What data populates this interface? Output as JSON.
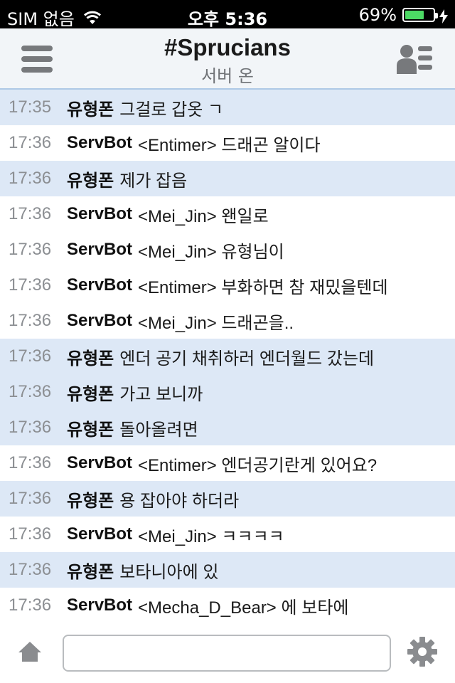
{
  "status_bar": {
    "carrier": "SIM 없음",
    "time": "오후 5:36",
    "battery_percent": "69%",
    "battery_level": 0.69
  },
  "header": {
    "title": "#Sprucians",
    "subtitle": "서버 온",
    "menu_icon": "hamburger-menu-icon",
    "users_icon": "user-list-icon"
  },
  "messages": [
    {
      "time": "17:35",
      "nick": "유형폰",
      "text": "그걸로 갑옷 ㄱ",
      "highlight": true
    },
    {
      "time": "17:36",
      "nick": "ServBot",
      "text": "<Entimer> 드래곤 알이다",
      "highlight": false
    },
    {
      "time": "17:36",
      "nick": "유형폰",
      "text": "제가 잡음",
      "highlight": true
    },
    {
      "time": "17:36",
      "nick": "ServBot",
      "text": "<Mei_Jin> 왠일로",
      "highlight": false
    },
    {
      "time": "17:36",
      "nick": "ServBot",
      "text": "<Mei_Jin> 유형님이",
      "highlight": false
    },
    {
      "time": "17:36",
      "nick": "ServBot",
      "text": "<Entimer> 부화하면 참 재밌을텐데",
      "highlight": false
    },
    {
      "time": "17:36",
      "nick": "ServBot",
      "text": "<Mei_Jin> 드래곤을..",
      "highlight": false
    },
    {
      "time": "17:36",
      "nick": "유형폰",
      "text": "엔더 공기 채취하러 엔더월드 갔는데",
      "highlight": true
    },
    {
      "time": "17:36",
      "nick": "유형폰",
      "text": "가고 보니까",
      "highlight": true
    },
    {
      "time": "17:36",
      "nick": "유형폰",
      "text": "돌아올려면",
      "highlight": true
    },
    {
      "time": "17:36",
      "nick": "ServBot",
      "text": "<Entimer> 엔더공기란게 있어요?",
      "highlight": false
    },
    {
      "time": "17:36",
      "nick": "유형폰",
      "text": "용 잡아야 하더라",
      "highlight": true
    },
    {
      "time": "17:36",
      "nick": "ServBot",
      "text": "<Mei_Jin> ㅋㅋㅋㅋ",
      "highlight": false
    },
    {
      "time": "17:36",
      "nick": "유형폰",
      "text": "보타니아에 있",
      "highlight": true
    },
    {
      "time": "17:36",
      "nick": "ServBot",
      "text": "<Mecha_D_Bear> 에 보타에",
      "highlight": false
    }
  ],
  "input_bar": {
    "message_value": "",
    "message_placeholder": "",
    "home_icon": "home-icon",
    "settings_icon": "gear-icon"
  },
  "colors": {
    "highlight_row": "#dde8f6",
    "header_bg": "#f2f5f8",
    "header_border": "#aec9e6",
    "battery_fill": "#4cd964",
    "timestamp": "#8c8f93"
  }
}
